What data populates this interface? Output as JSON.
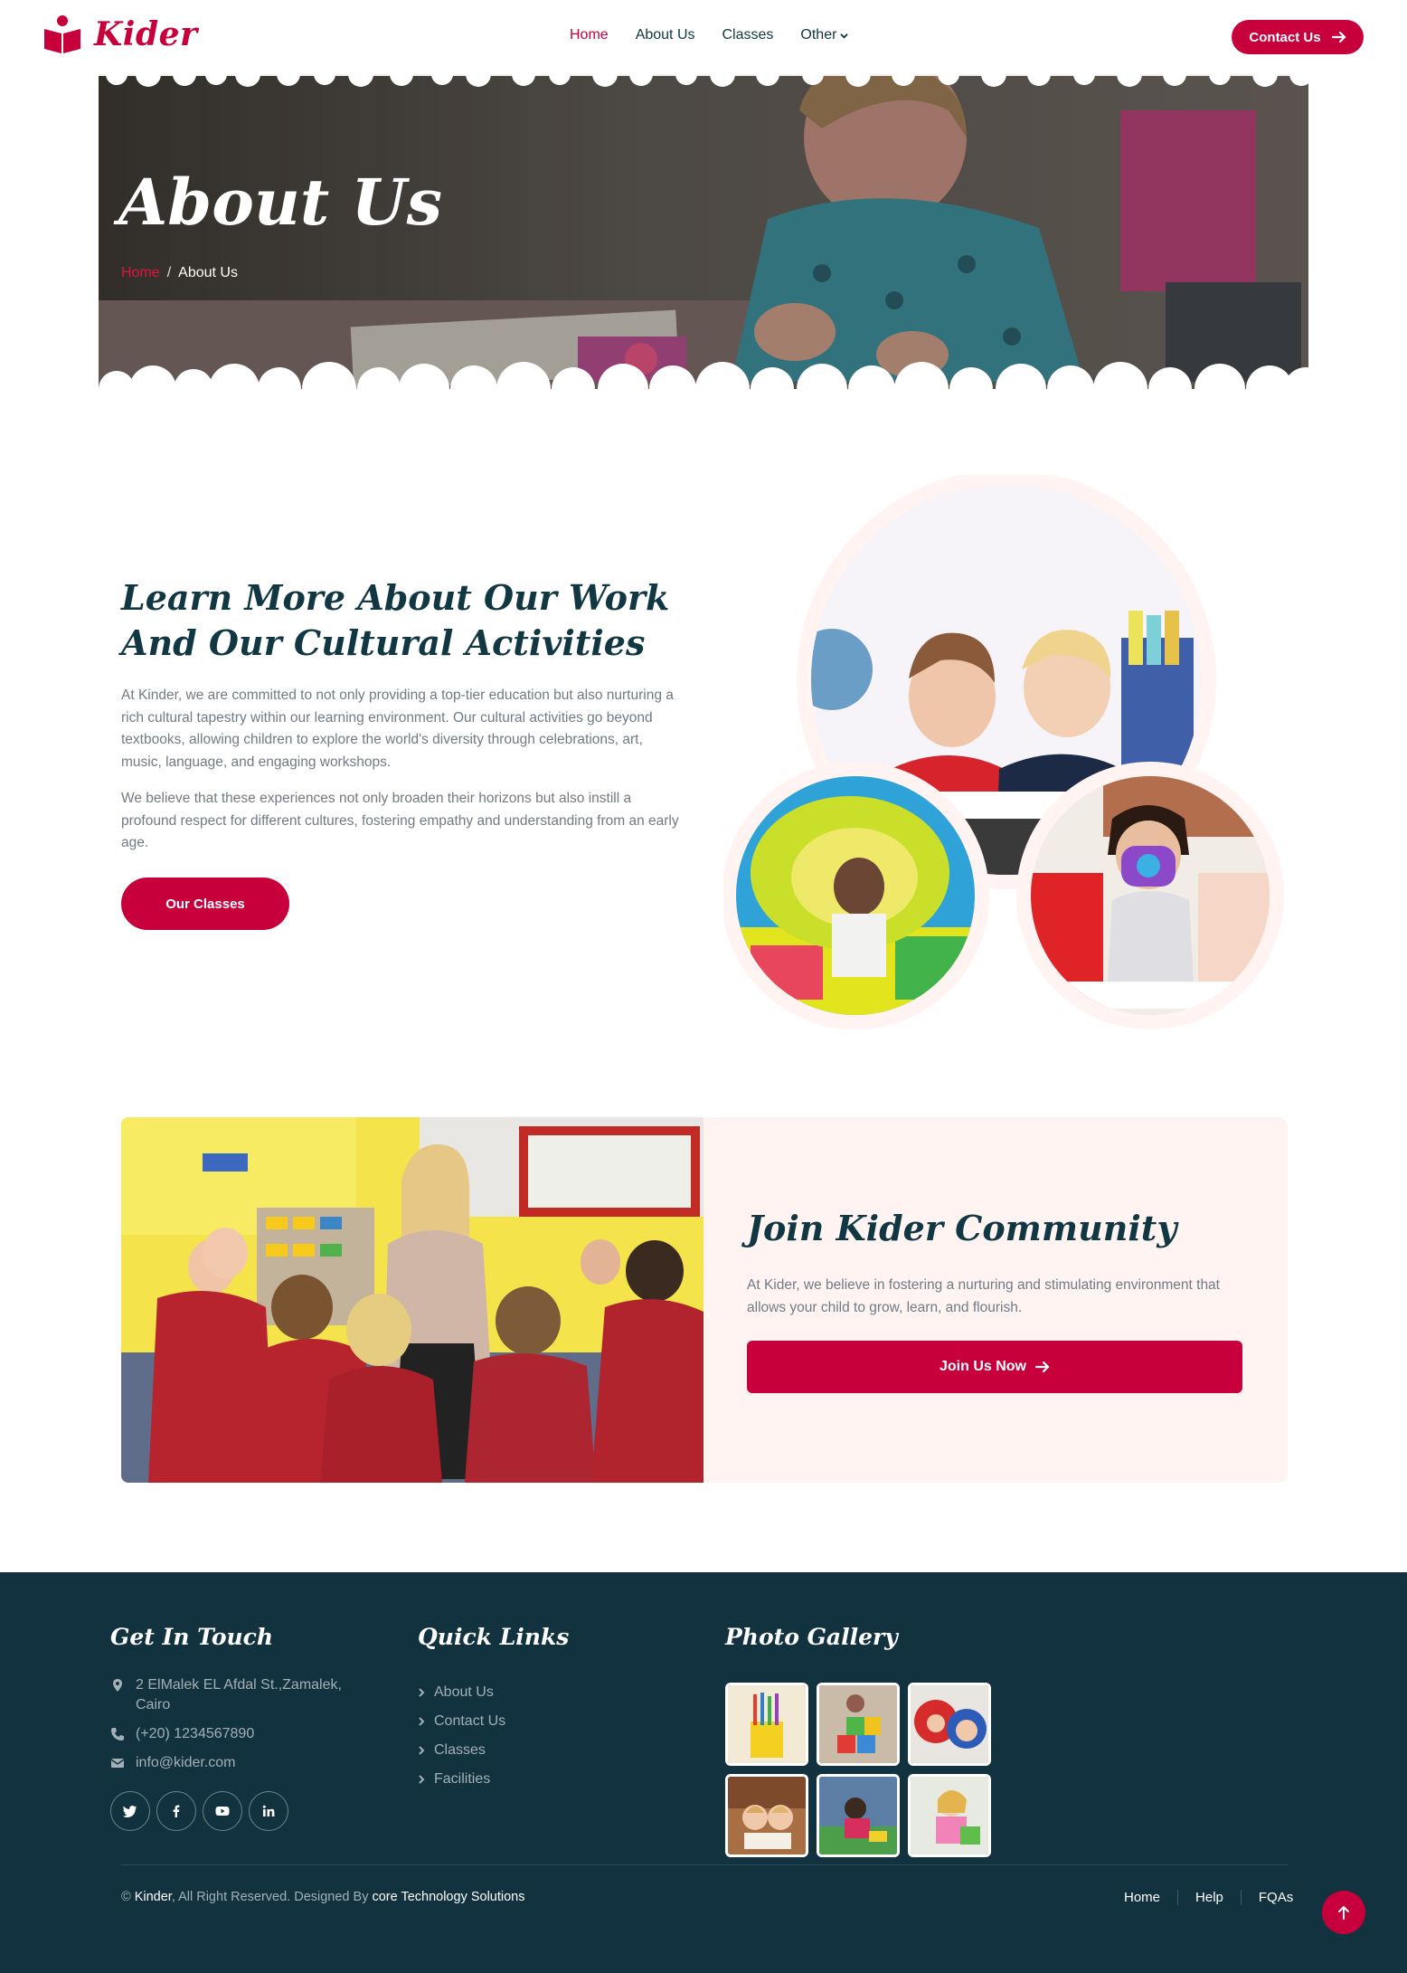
{
  "brand": {
    "name": "Kider",
    "color": "#c7003b"
  },
  "nav": {
    "items": [
      {
        "label": "Home",
        "active": true
      },
      {
        "label": "About Us",
        "active": false
      },
      {
        "label": "Classes",
        "active": false
      },
      {
        "label": "Other",
        "active": false
      }
    ],
    "cta_label": "Contact Us"
  },
  "hero": {
    "title": "About Us",
    "breadcrumb": {
      "home": "Home",
      "separator": "/",
      "current": "About Us"
    }
  },
  "about": {
    "title": "Learn More About Our Work And Our Cultural Activities",
    "paragraph1": "At Kinder, we are committed to not only providing a top-tier education but also nurturing a rich cultural tapestry within our learning environment. Our cultural activities go beyond textbooks, allowing children to explore the world's diversity through celebrations, art, music, language, and engaging workshops.",
    "paragraph2": "We believe that these experiences not only broaden their horizons but also instill a profound respect for different cultures, fostering empathy and understanding from an early age.",
    "button_label": "Our Classes"
  },
  "join": {
    "title": "Join Kider Community",
    "paragraph": "At Kider, we believe in fostering a nurturing and stimulating environment that allows your child to grow, learn, and flourish.",
    "button_label": "Join Us Now"
  },
  "footer": {
    "contact_heading": "Get In Touch",
    "address": "2 ElMalek EL Afdal St.,Zamalek, Cairo",
    "phone": "(+20) 1234567890",
    "email": "info@kider.com",
    "social_icons": [
      "twitter-icon",
      "facebook-icon",
      "youtube-icon",
      "linkedin-icon"
    ],
    "links_heading": "Quick Links",
    "links": [
      "About Us",
      "Contact Us",
      "Classes",
      "Facilities"
    ],
    "gallery_heading": "Photo Gallery",
    "copyright": {
      "prefix": "©",
      "brand": "Kinder",
      "middle": ", All Right Reserved. Designed By",
      "designer": "core Technology Solutions"
    },
    "bottom_links": [
      "Home",
      "Help",
      "FQAs"
    ]
  },
  "colors": {
    "accent": "#c7003b",
    "dark": "#103742",
    "footer_bg": "#12323f",
    "join_bg": "#fff4f2"
  }
}
